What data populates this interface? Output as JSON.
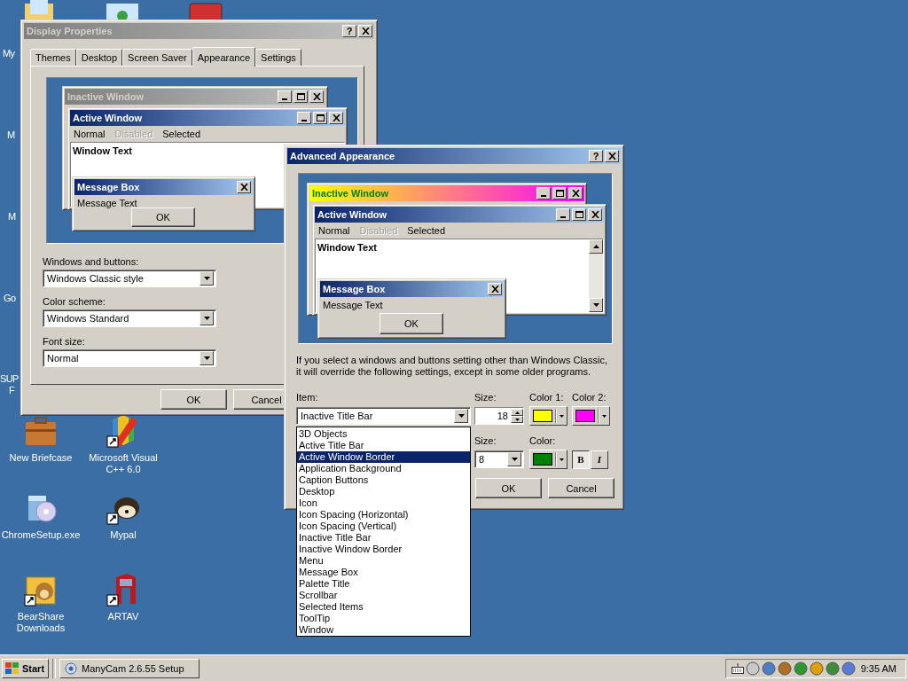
{
  "desktop_icons_partial": [
    {
      "label": "My"
    },
    {
      "label": "M"
    },
    {
      "label": "M"
    },
    {
      "label": "Go"
    },
    {
      "label": "SUP"
    },
    {
      "label": "F"
    }
  ],
  "desktop_icons": [
    {
      "label": "New Briefcase"
    },
    {
      "label": "Microsoft Visual C++ 6.0"
    },
    {
      "label": "ChromeSetup.exe"
    },
    {
      "label": "Mypal"
    },
    {
      "label": "BearShare Downloads"
    },
    {
      "label": "ARTAV"
    }
  ],
  "display_properties": {
    "title": "Display Properties",
    "active": false,
    "help": "?",
    "tabs": [
      {
        "label": "Themes",
        "selected": false
      },
      {
        "label": "Desktop",
        "selected": false
      },
      {
        "label": "Screen Saver",
        "selected": false
      },
      {
        "label": "Appearance",
        "selected": true
      },
      {
        "label": "Settings",
        "selected": false
      }
    ],
    "preview": {
      "inactive_title": "Inactive Window",
      "active_title": "Active Window",
      "menu": [
        {
          "label": "Normal",
          "disabled": false
        },
        {
          "label": "Disabled",
          "disabled": true
        },
        {
          "label": "Selected",
          "disabled": false
        }
      ],
      "window_text": "Window Text",
      "message_title": "Message Box",
      "message_text": "Message Text",
      "ok": "OK",
      "scrollbar": false
    },
    "fields": [
      {
        "label": "Windows and buttons:",
        "value": "Windows Classic style"
      },
      {
        "label": "Color scheme:",
        "value": "Windows Standard"
      },
      {
        "label": "Font size:",
        "value": "Normal"
      }
    ],
    "buttons": [
      "OK",
      "Cancel"
    ]
  },
  "advanced": {
    "title": "Advanced Appearance",
    "active": true,
    "help": "?",
    "preview": {
      "inactive_title": "Inactive Window",
      "active_title": "Active Window",
      "menu": [
        {
          "label": "Normal",
          "disabled": false
        },
        {
          "label": "Disabled",
          "disabled": true
        },
        {
          "label": "Selected",
          "disabled": false
        }
      ],
      "window_text": "Window Text",
      "message_title": "Message Box",
      "message_text": "Message Text",
      "ok": "OK",
      "scrollbar": true
    },
    "note": "If you select a windows and buttons setting other than Windows Classic, it will override the following settings, except in some older programs.",
    "item_label": "Item:",
    "item_value": "Inactive Title Bar",
    "size_label": "Size:",
    "size_value": "18",
    "color1_label": "Color 1:",
    "color2_label": "Color 2:",
    "font_size_label": "Size:",
    "font_size": "8",
    "font_color_label": "Color:",
    "bold": true,
    "italic": false,
    "bold_label": "B",
    "italic_label": "I",
    "dropdown": [
      {
        "label": "3D Objects",
        "selected": false
      },
      {
        "label": "Active Title Bar",
        "selected": false
      },
      {
        "label": "Active Window Border",
        "selected": true
      },
      {
        "label": "Application Background",
        "selected": false
      },
      {
        "label": "Caption Buttons",
        "selected": false
      },
      {
        "label": "Desktop",
        "selected": false
      },
      {
        "label": "Icon",
        "selected": false
      },
      {
        "label": "Icon Spacing (Horizontal)",
        "selected": false
      },
      {
        "label": "Icon Spacing (Vertical)",
        "selected": false
      },
      {
        "label": "Inactive Title Bar",
        "selected": false
      },
      {
        "label": "Inactive Window Border",
        "selected": false
      },
      {
        "label": "Menu",
        "selected": false
      },
      {
        "label": "Message Box",
        "selected": false
      },
      {
        "label": "Palette Title",
        "selected": false
      },
      {
        "label": "Scrollbar",
        "selected": false
      },
      {
        "label": "Selected Items",
        "selected": false
      },
      {
        "label": "ToolTip",
        "selected": false
      },
      {
        "label": "Window",
        "selected": false
      }
    ],
    "buttons": [
      "OK",
      "Cancel"
    ]
  },
  "taskbar": {
    "start": "Start",
    "tasks": [
      {
        "label": "ManyCam 2.6.55 Setup",
        "selected": false
      }
    ],
    "clock": "9:35 AM"
  }
}
